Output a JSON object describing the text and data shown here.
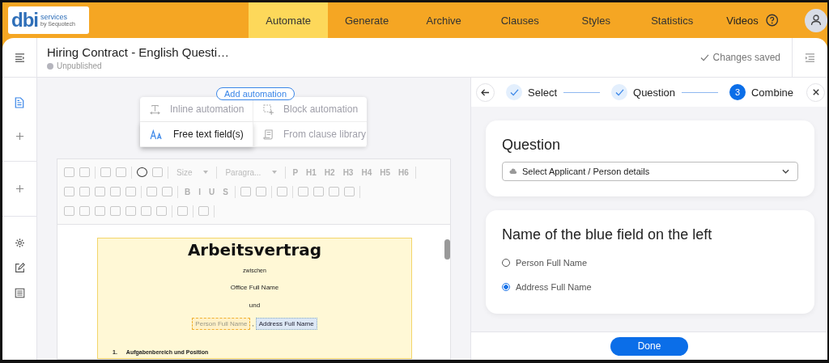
{
  "nav": {
    "tabs": [
      {
        "label": "Automate",
        "selected": true
      },
      {
        "label": "Generate",
        "selected": false
      },
      {
        "label": "Archive",
        "selected": false
      },
      {
        "label": "Clauses",
        "selected": false
      },
      {
        "label": "Styles",
        "selected": false
      },
      {
        "label": "Statistics",
        "selected": false
      }
    ],
    "videos": "Videos"
  },
  "logo": {
    "main": "dbi",
    "line1": "services",
    "line2": "by Sequotech"
  },
  "header": {
    "title": "Hiring Contract - English Questi…",
    "status": "Unpublished",
    "saved": "Changes saved"
  },
  "automation": {
    "button": "Add automation",
    "options": [
      {
        "label": "Inline automation",
        "selected": false
      },
      {
        "label": "Block automation",
        "selected": false
      },
      {
        "label": "Free text field(s)",
        "selected": true
      },
      {
        "label": "From clause library",
        "selected": false
      }
    ]
  },
  "toolbar": {
    "rows": [
      [
        {
          "kind": "icon"
        },
        {
          "kind": "icon"
        },
        {
          "kind": "sep"
        },
        {
          "kind": "icon"
        },
        {
          "kind": "icon"
        },
        {
          "kind": "sep"
        },
        {
          "kind": "icon",
          "active": true
        },
        {
          "kind": "icon"
        },
        {
          "kind": "sep"
        },
        {
          "kind": "select",
          "label": "Size"
        },
        {
          "kind": "sep"
        },
        {
          "kind": "select",
          "label": "Paragra..."
        },
        {
          "kind": "sep"
        },
        {
          "kind": "text",
          "label": "P"
        },
        {
          "kind": "text",
          "label": "H1"
        },
        {
          "kind": "text",
          "label": "H2"
        },
        {
          "kind": "text",
          "label": "H3"
        },
        {
          "kind": "text",
          "label": "H4"
        },
        {
          "kind": "text",
          "label": "H5"
        },
        {
          "kind": "text",
          "label": "H6"
        },
        {
          "kind": "sep"
        }
      ],
      [
        {
          "kind": "icon"
        },
        {
          "kind": "icon"
        },
        {
          "kind": "icon"
        },
        {
          "kind": "icon"
        },
        {
          "kind": "icon"
        },
        {
          "kind": "sep"
        },
        {
          "kind": "icon"
        },
        {
          "kind": "icon"
        },
        {
          "kind": "sep"
        },
        {
          "kind": "text",
          "label": "B"
        },
        {
          "kind": "text",
          "label": "I"
        },
        {
          "kind": "text",
          "label": "U"
        },
        {
          "kind": "text",
          "label": "S"
        },
        {
          "kind": "sep"
        },
        {
          "kind": "icon"
        },
        {
          "kind": "icon"
        },
        {
          "kind": "sep"
        },
        {
          "kind": "icon"
        },
        {
          "kind": "sep"
        },
        {
          "kind": "icon"
        },
        {
          "kind": "icon"
        },
        {
          "kind": "icon"
        },
        {
          "kind": "icon"
        },
        {
          "kind": "sep"
        }
      ],
      [
        {
          "kind": "icon"
        },
        {
          "kind": "icon"
        },
        {
          "kind": "icon"
        },
        {
          "kind": "icon"
        },
        {
          "kind": "icon"
        },
        {
          "kind": "icon"
        },
        {
          "kind": "icon"
        },
        {
          "kind": "sep"
        },
        {
          "kind": "icon"
        },
        {
          "kind": "sep"
        },
        {
          "kind": "icon"
        },
        {
          "kind": "sep"
        }
      ]
    ]
  },
  "document": {
    "title": "Arbeitsvertrag",
    "lines": [
      "zwischen",
      "Office Full Name",
      "und"
    ],
    "fields": [
      {
        "label": "Person Full Name",
        "kind": "dashed"
      },
      {
        "label": ", ",
        "kind": "plain"
      },
      {
        "label": "Address Full Name",
        "kind": "selected"
      }
    ],
    "section_number": "1.",
    "section_title": "Aufgabenbereich und Position"
  },
  "stepper": {
    "steps": [
      {
        "label": "Select",
        "done": true
      },
      {
        "label": "Question",
        "done": true
      },
      {
        "label": "Combine",
        "number": "3",
        "done": false
      }
    ]
  },
  "question": {
    "title": "Question",
    "value": "Select Applicant / Person details"
  },
  "field_name": {
    "title": "Name of the blue field on the left",
    "options": [
      {
        "label": "Person Full Name",
        "selected": false
      },
      {
        "label": "Address Full Name",
        "selected": true
      }
    ]
  },
  "done": "Done"
}
